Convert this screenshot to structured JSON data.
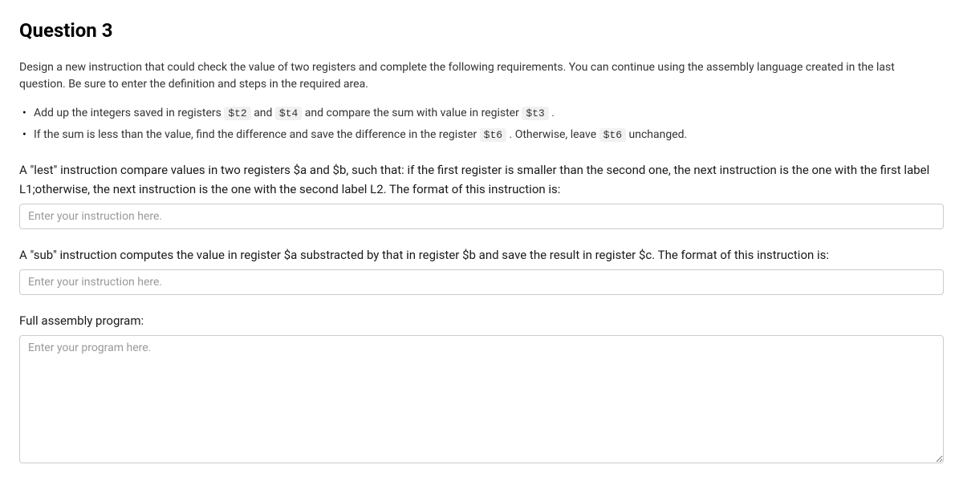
{
  "title": "Question 3",
  "description": "Design a new instruction that could check the value of two registers and complete the following requirements. You can continue using the assembly language created in the last question. Be sure to enter the definition and steps in the required area.",
  "bullets": [
    {
      "pre1": "Add up the integers saved in registers ",
      "code1": "$t2",
      "mid1": " and ",
      "code2": "$t4",
      "mid2": " and compare the sum with value in register ",
      "code3": "$t3",
      "post": " ."
    },
    {
      "pre1": "If the sum is less than the value, find the difference and save the difference in the register ",
      "code1": "$t6",
      "mid1": " . Otherwise, leave ",
      "code2": "$t6",
      "post": " unchanged."
    }
  ],
  "prompt1": "A \"lest\" instruction compare values in two registers $a and $b, such that: if the first register is smaller than the second one, the next instruction is the one with the first label L1;otherwise, the next instruction is the one with the second label L2. The format of this instruction is:",
  "input1_placeholder": "Enter your instruction here.",
  "prompt2": "A \"sub\" instruction computes the value in register $a substracted by that in register $b and save the result in register $c. The format of this instruction is:",
  "input2_placeholder": "Enter your instruction here.",
  "prompt3": "Full assembly program:",
  "textarea_placeholder": "Enter your program here."
}
